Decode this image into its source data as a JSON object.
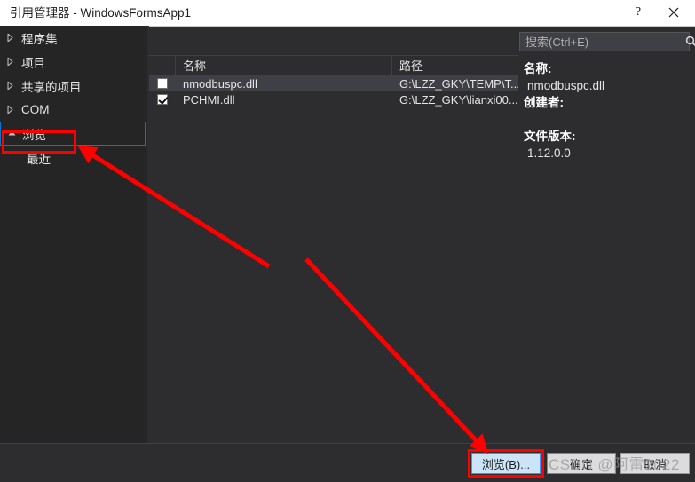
{
  "window": {
    "title": "引用管理器 - WindowsFormsApp1",
    "help_label": "?",
    "close_label": "✕"
  },
  "sidebar": {
    "items": [
      {
        "label": "程序集",
        "expander": "collapsed",
        "selected": false
      },
      {
        "label": "项目",
        "expander": "collapsed",
        "selected": false
      },
      {
        "label": "共享的项目",
        "expander": "collapsed",
        "selected": false
      },
      {
        "label": "COM",
        "expander": "collapsed",
        "selected": false
      },
      {
        "label": "浏览",
        "expander": "expanded",
        "selected": true
      }
    ],
    "sub_items": [
      {
        "label": "最近"
      }
    ]
  },
  "search": {
    "placeholder": "搜索(Ctrl+E)",
    "value": "",
    "icon": "search-icon",
    "caret": "▾"
  },
  "list": {
    "columns": [
      "",
      "名称",
      "路径"
    ],
    "rows": [
      {
        "checked": false,
        "name": "nmodbuspc.dll",
        "path": "G:\\LZZ_GKY\\TEMP\\T...",
        "selected": true
      },
      {
        "checked": true,
        "name": "PCHMI.dll",
        "path": "G:\\LZZ_GKY\\lianxi00...",
        "selected": false
      }
    ]
  },
  "detail": {
    "name_label": "名称:",
    "name_value": "nmodbuspc.dll",
    "creator_label": "创建者:",
    "creator_value": "",
    "version_label": "文件版本:",
    "version_value": "1.12.0.0"
  },
  "buttons": {
    "browse": "浏览(B)...",
    "ok": "确定",
    "cancel": "取消"
  },
  "watermark": {
    "text": "CSDN @阿雷2022"
  },
  "annotations": {
    "accent_red": "#ff0000",
    "accent_blue": "#007acc",
    "highlight_button": "#cce4f7"
  }
}
